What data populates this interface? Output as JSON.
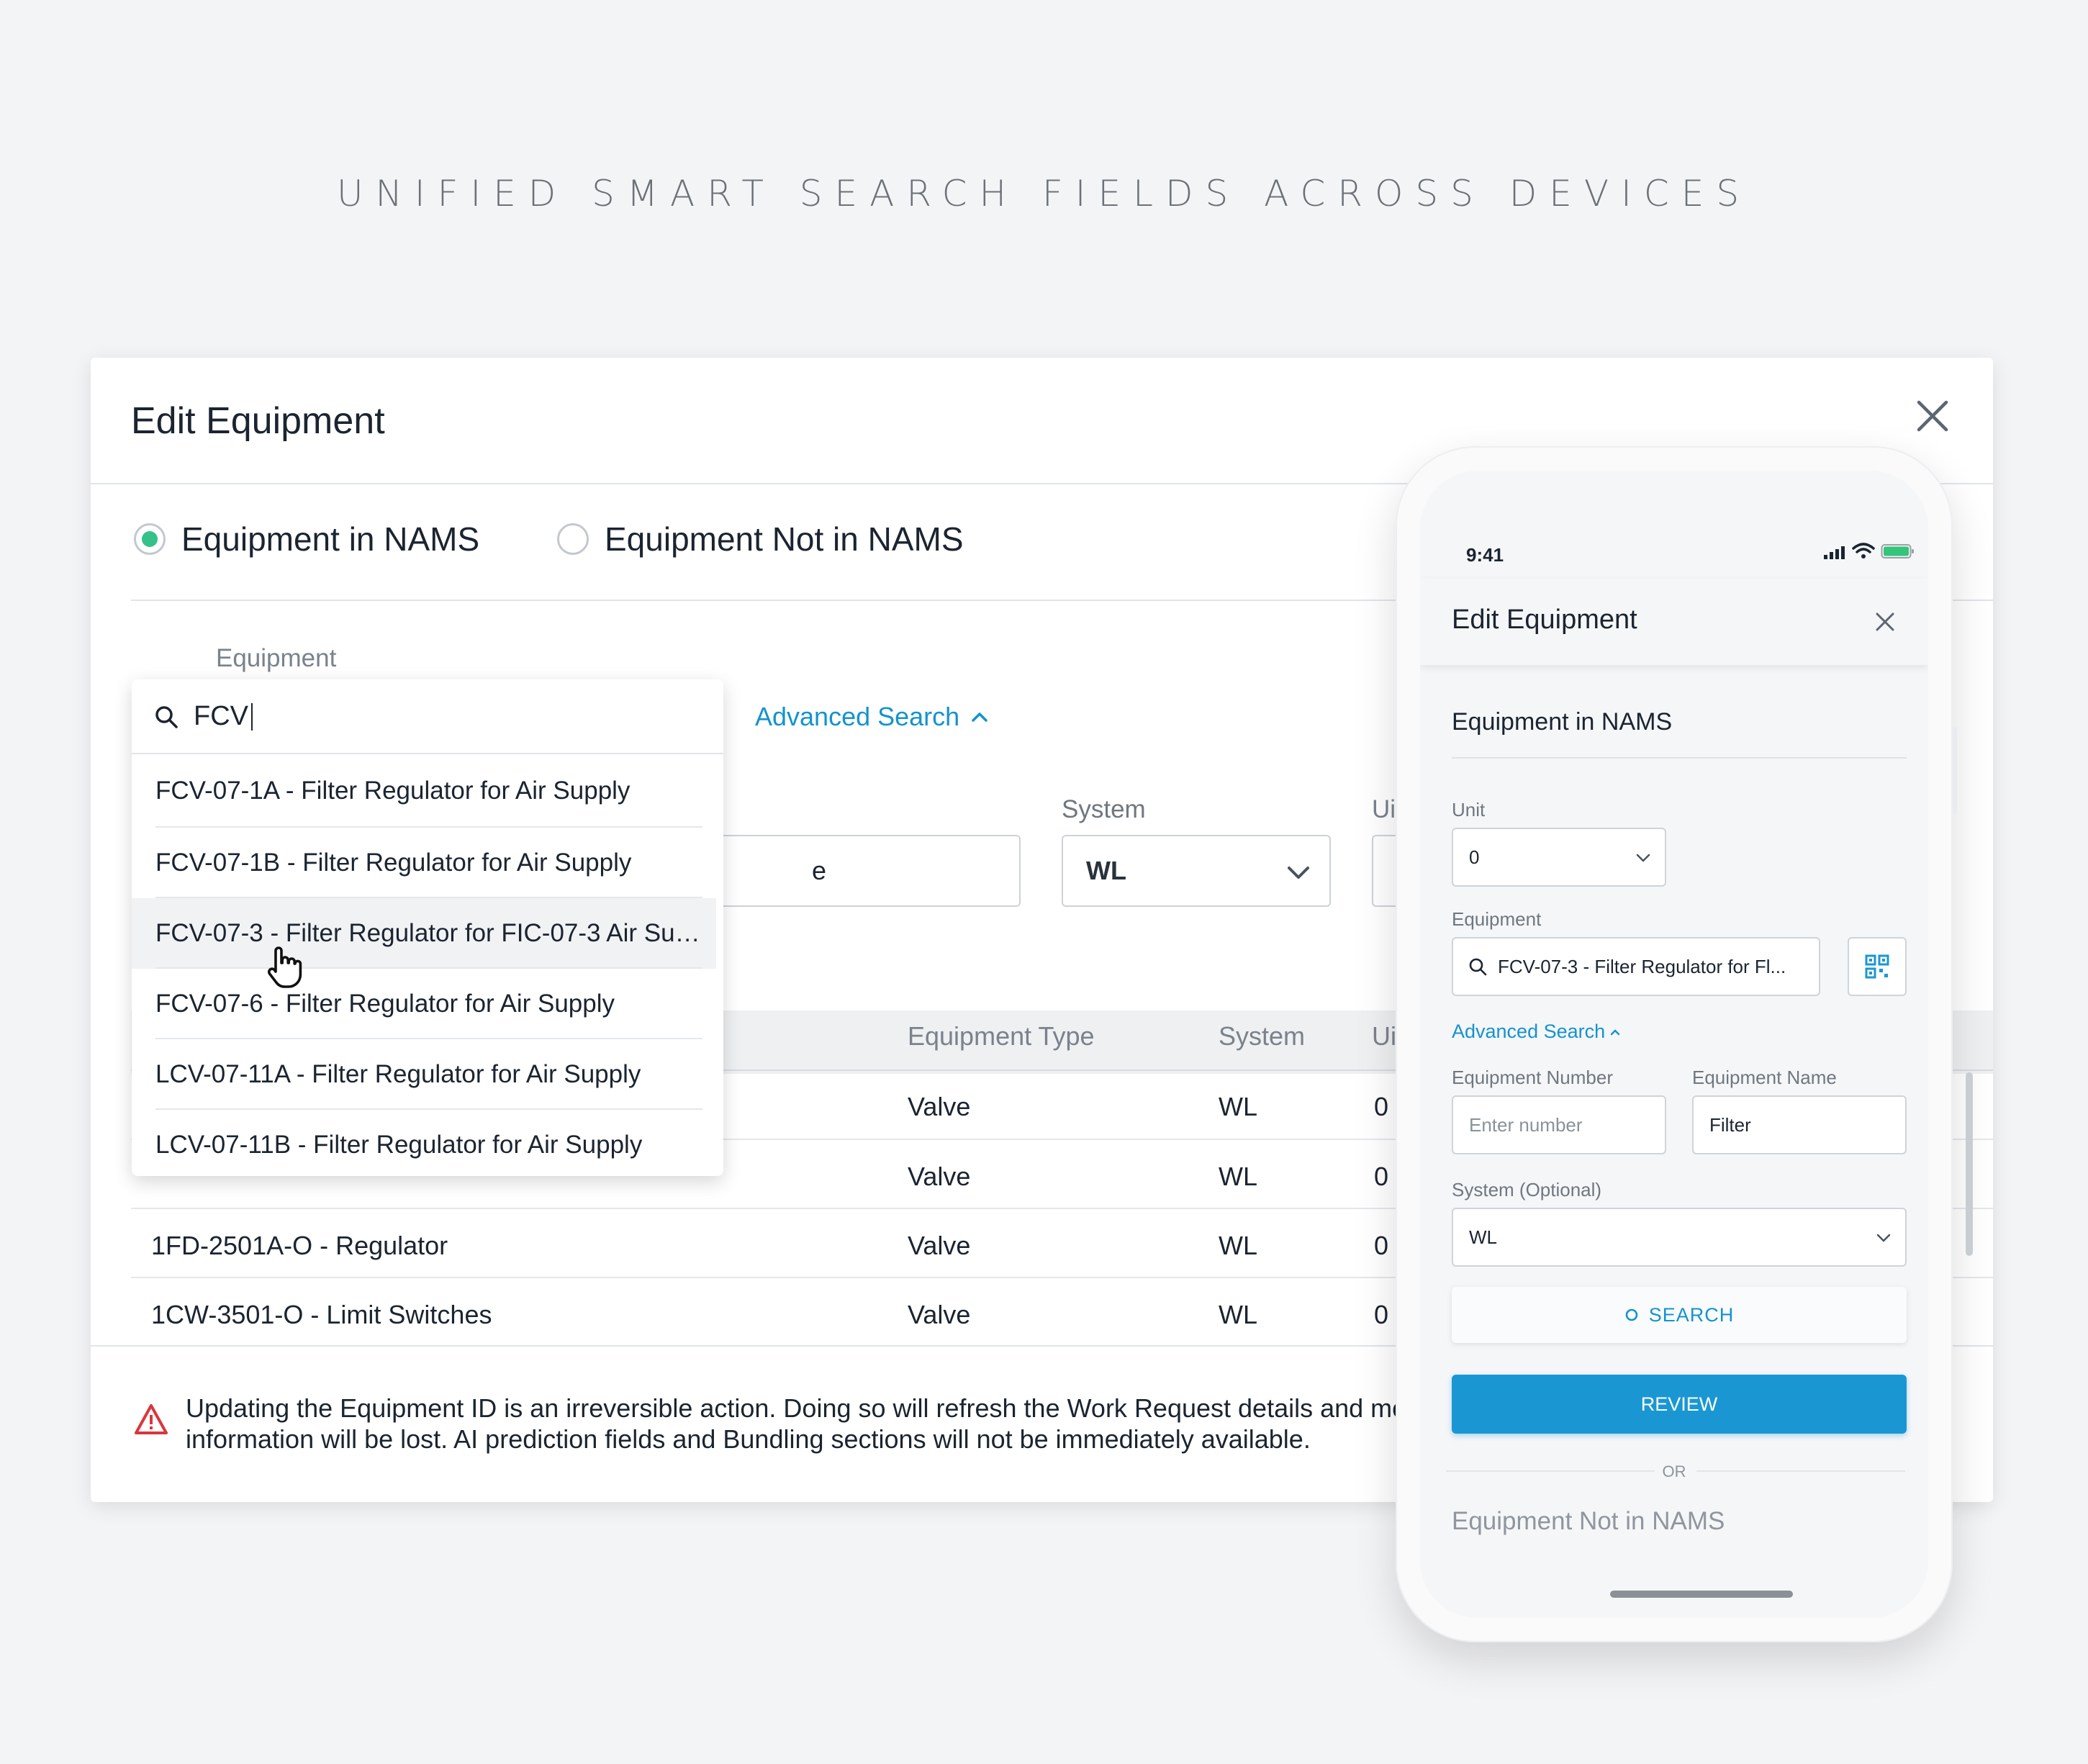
{
  "headline": "UNIFIED SMART SEARCH FIELDS ACROSS DEVICES",
  "desktop": {
    "title": "Edit Equipment",
    "radios": [
      {
        "label": "Equipment in NAMS",
        "selected": true
      },
      {
        "label": "Equipment Not in NAMS",
        "selected": false
      }
    ],
    "equipment_label": "Equipment",
    "search_value": "FCV",
    "advanced_search": "Advanced Search",
    "field_partial_text": "e",
    "system_label": "System",
    "system_value": "WL",
    "unit_label_partial": "Ui",
    "dropdown_items": [
      "FCV-07-1A - Filter Regulator for Air Supply",
      "FCV-07-1B - Filter Regulator for Air Supply",
      "FCV-07-3 - Filter Regulator for FIC-07-3 Air Su…",
      "FCV-07-6 - Filter Regulator for Air Supply",
      "LCV-07-11A - Filter Regulator for Air Supply",
      "LCV-07-11B - Filter Regulator for Air Supply"
    ],
    "table": {
      "headers": {
        "type": "Equipment Type",
        "system": "System",
        "unit": "Ui"
      },
      "rows": [
        {
          "name": "",
          "type": "Valve",
          "system": "WL",
          "unit": "0"
        },
        {
          "name": "",
          "type": "Valve",
          "system": "WL",
          "unit": "0"
        },
        {
          "name": "1FD-2501A-O - Regulator",
          "type": "Valve",
          "system": "WL",
          "unit": "0"
        },
        {
          "name": "1CW-3501-O - Limit Switches",
          "type": "Valve",
          "system": "WL",
          "unit": "0"
        }
      ]
    },
    "warning": "Updating the Equipment ID is an irreversible action. Doing so will refresh the Work Request details and mos current information will be lost. AI prediction fields and Bundling sections will not be immediately available."
  },
  "phone": {
    "time": "9:41",
    "title": "Edit Equipment",
    "section": "Equipment in NAMS",
    "unit_label": "Unit",
    "unit_value": "0",
    "equipment_label": "Equipment",
    "equipment_value": "FCV-07-3 - Filter Regulator for Fl...",
    "advanced_search": "Advanced Search",
    "equipment_number_label": "Equipment Number",
    "equipment_number_placeholder": "Enter number",
    "equipment_name_label": "Equipment Name",
    "equipment_name_value": "Filter",
    "system_label": "System (Optional)",
    "system_value": "WL",
    "search_button": "SEARCH",
    "review_button": "REVIEW",
    "or_text": "OR",
    "not_in_nams": "Equipment Not in NAMS"
  },
  "colors": {
    "accent": "#1493cf",
    "primary_button": "#1a97d3",
    "radio_selected": "#36c18a",
    "warning": "#d9363e"
  }
}
